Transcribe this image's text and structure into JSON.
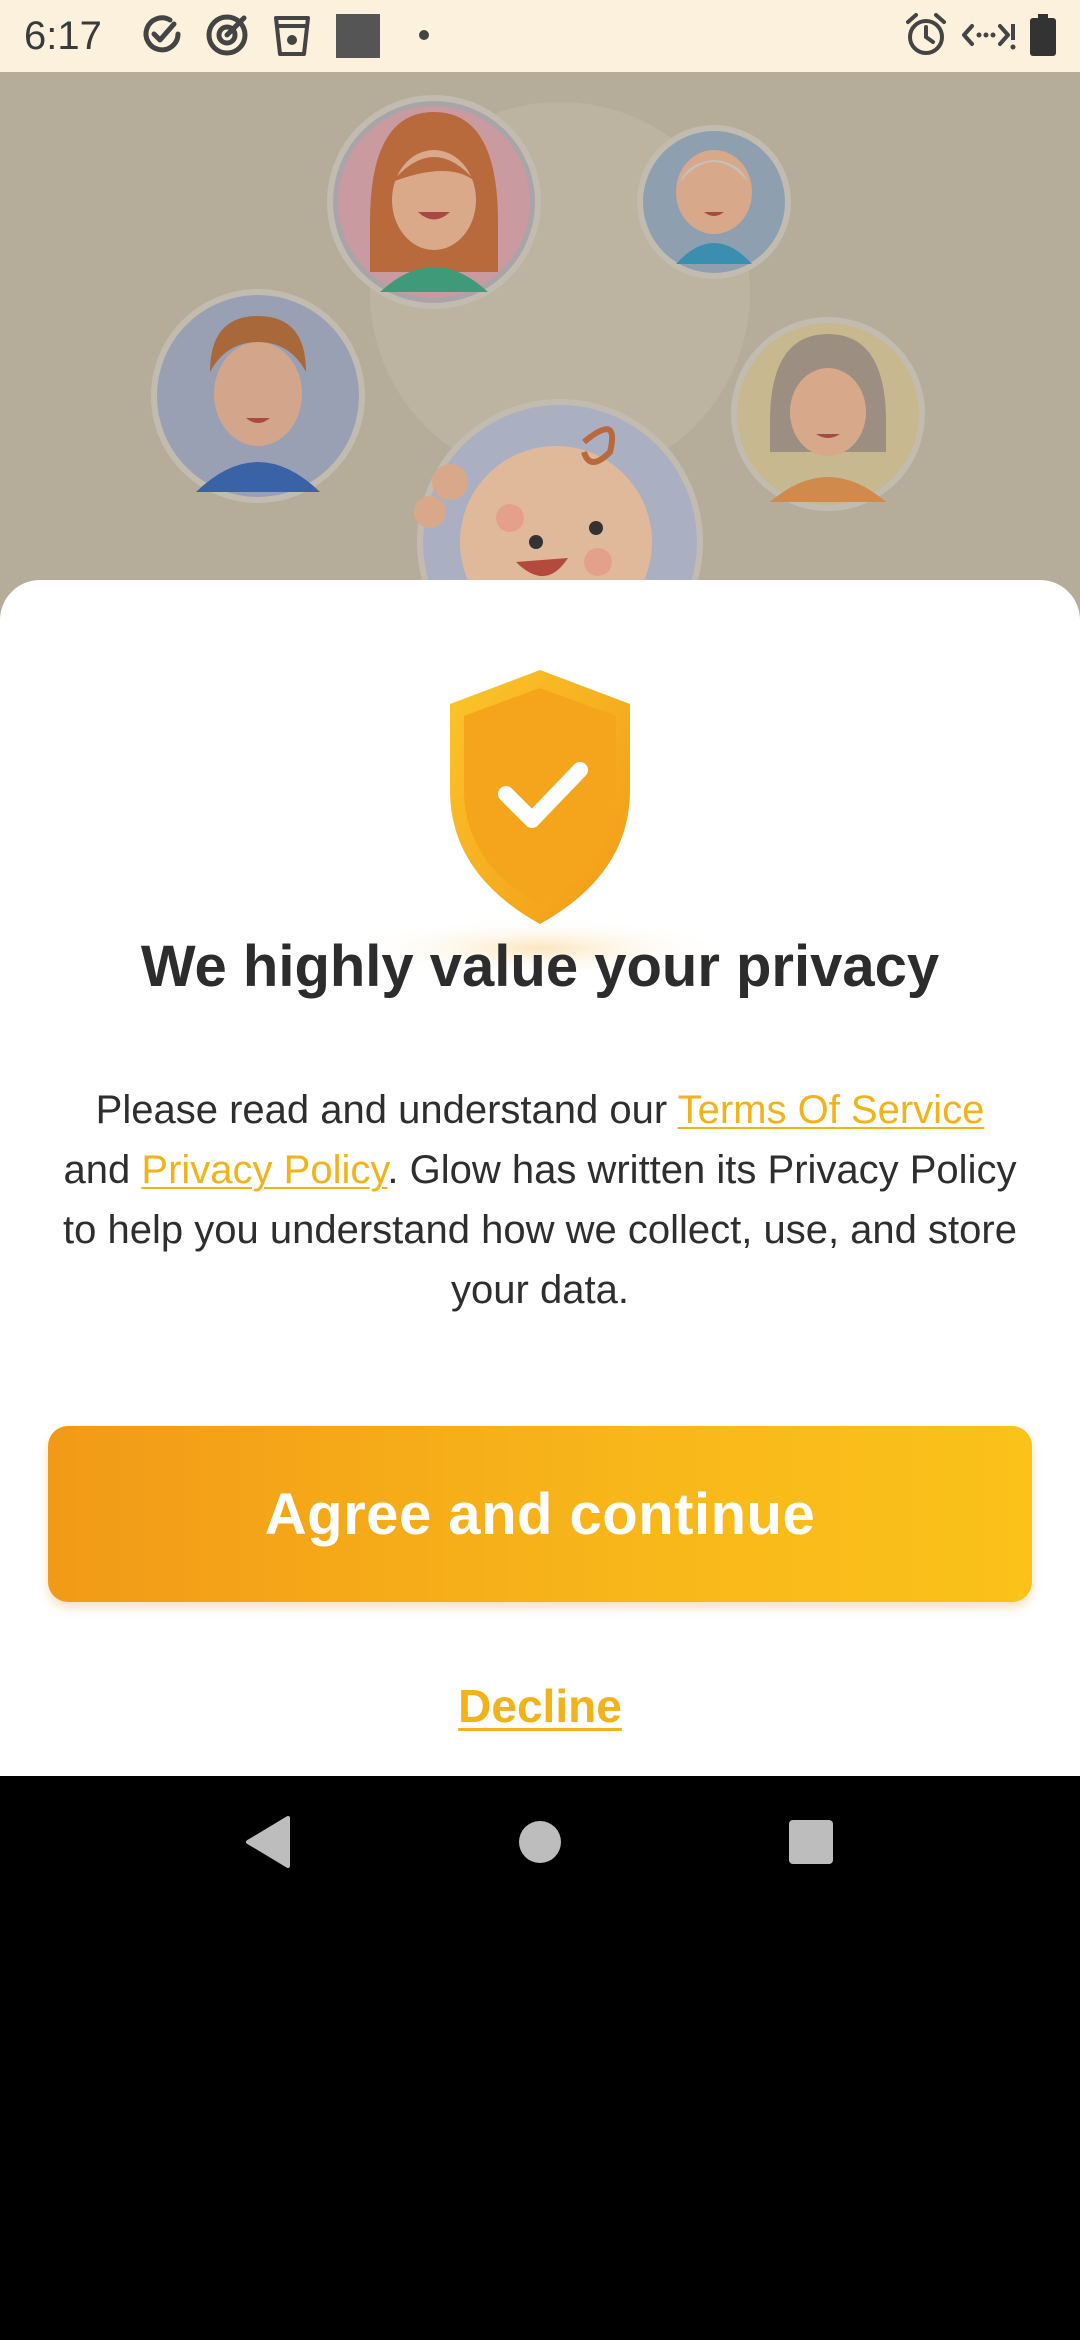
{
  "status_bar": {
    "time": "6:17",
    "left_icons": [
      "task-check-icon",
      "target-check-icon",
      "cup-icon",
      "square-app-icon",
      "notification-dot-icon"
    ],
    "right_icons": [
      "alarm-icon",
      "data-saver-icon",
      "battery-icon"
    ]
  },
  "hero": {
    "illustration": "family-avatars-illustration",
    "avatars": [
      "woman-avatar-icon",
      "grandfather-avatar-icon",
      "man-avatar-icon",
      "grandmother-avatar-icon",
      "baby-avatar-icon"
    ]
  },
  "privacy": {
    "badge_icon": "shield-check-icon",
    "title": "We highly value your privacy",
    "text_intro": "Please read and understand our ",
    "terms_link": "Terms Of Service",
    "text_and": " and ",
    "privacy_link": "Privacy Policy",
    "text_rest": ". Glow has written its Privacy Policy to help you understand how we collect, use, and store your data.",
    "agree_label": "Agree and continue",
    "decline_label": "Decline"
  },
  "nav_bar": {
    "icons": [
      "back-icon",
      "home-icon",
      "recents-icon"
    ]
  },
  "colors": {
    "accent": "#f2b21a",
    "button_gradient_start": "#f29a17",
    "button_gradient_end": "#fbc21a",
    "status_bar_bg": "#fbf1dc",
    "scrim_bg": "#b5ad99"
  }
}
